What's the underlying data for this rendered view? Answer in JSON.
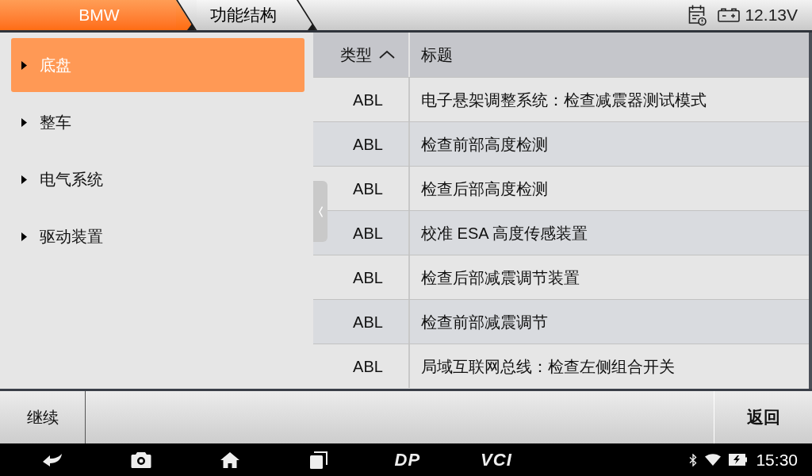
{
  "header": {
    "breadcrumbs": [
      {
        "label": "BMW",
        "kind": "brand"
      },
      {
        "label": "功能结构",
        "kind": "step"
      }
    ],
    "voltage": "12.13V"
  },
  "sidebar": {
    "items": [
      {
        "label": "底盘",
        "selected": true
      },
      {
        "label": "整车",
        "selected": false
      },
      {
        "label": "电气系统",
        "selected": false
      },
      {
        "label": "驱动装置",
        "selected": false
      }
    ]
  },
  "table": {
    "columns": [
      {
        "label": "类型",
        "sorted": true
      },
      {
        "label": "标题",
        "sorted": false
      }
    ],
    "rows": [
      {
        "type": "ABL",
        "title": "电子悬架调整系统：检查减震器测试模式"
      },
      {
        "type": "ABL",
        "title": "检查前部高度检测"
      },
      {
        "type": "ABL",
        "title": "检查后部高度检测"
      },
      {
        "type": "ABL",
        "title": "校准 ESA 高度传感装置"
      },
      {
        "type": "ABL",
        "title": "检查后部减震调节装置"
      },
      {
        "type": "ABL",
        "title": "检查前部减震调节"
      },
      {
        "type": "ABL",
        "title": "局域互联网总线：检查左侧组合开关"
      }
    ]
  },
  "footer": {
    "left_button": "继续",
    "right_button": "返回"
  },
  "nav_bar": {
    "shortcuts": [
      "DP",
      "VCI"
    ],
    "time": "15:30"
  }
}
